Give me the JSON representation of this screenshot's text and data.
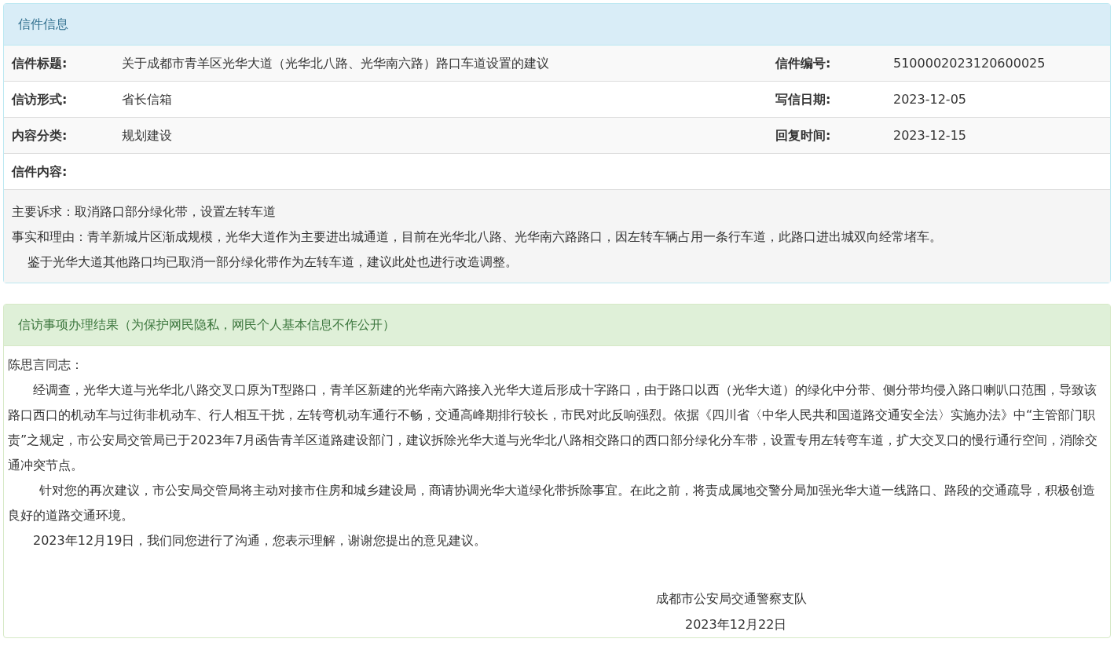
{
  "letter_panel": {
    "title": "信件信息",
    "rows": [
      [
        {
          "label": "信件标题:",
          "value": "关于成都市青羊区光华大道（光华北八路、光华南六路）路口车道设置的建议"
        },
        {
          "label": "信件编号:",
          "value": "5100002023120600025"
        }
      ],
      [
        {
          "label": "信访形式:",
          "value": "省长信箱"
        },
        {
          "label": "写信日期:",
          "value": "2023-12-05"
        }
      ],
      [
        {
          "label": "内容分类:",
          "value": "规划建设"
        },
        {
          "label": "回复时间:",
          "value": "2023-12-15"
        }
      ]
    ],
    "content_label": "信件内容:",
    "content": [
      {
        "text": "主要诉求：取消路口部分绿化带，设置左转车道",
        "indent": false
      },
      {
        "text": "事实和理由：青羊新城片区渐成规模，光华大道作为主要进出城通道，目前在光华北八路、光华南六路路口，因左转车辆占用一条行车道，此路口进出城双向经常堵车。",
        "indent": false
      },
      {
        "text": "鉴于光华大道其他路口均已取消一部分绿化带作为左转车道，建议此处也进行改造调整。",
        "indent": true
      }
    ]
  },
  "result_panel": {
    "title": "信访事项办理结果（为保护网民隐私，网民个人基本信息不作公开）",
    "salutation": "陈思言同志：",
    "paragraphs": [
      "经调查，光华大道与光华北八路交叉口原为T型路口，青羊区新建的光华南六路接入光华大道后形成十字路口，由于路口以西（光华大道）的绿化中分带、侧分带均侵入路口喇叭口范围，导致该路口西口的机动车与过街非机动车、行人相互干扰，左转弯机动车通行不畅，交通高峰期排行较长，市民对此反响强烈。依据《四川省〈中华人民共和国道路交通安全法〉实施办法》中“主管部门职责”之规定，市公安局交管局已于2023年7月函告青羊区道路建设部门，建议拆除光华大道与光华北八路相交路口的西口部分绿化分车带，设置专用左转弯车道，扩大交叉口的慢行通行空间，消除交通冲突节点。",
      "针对您的再次建议，市公安局交管局将主动对接市住房和城乡建设局，商请协调光华大道绿化带拆除事宜。在此之前，将责成属地交警分局加强光华大道一线路口、路段的交通疏导，积极创造良好的道路交通环境。",
      "2023年12月19日，我们同您进行了沟通，您表示理解，谢谢您提出的意见建议。"
    ],
    "signature": "成都市公安局交通警察支队",
    "date": "2023年12月22日"
  }
}
